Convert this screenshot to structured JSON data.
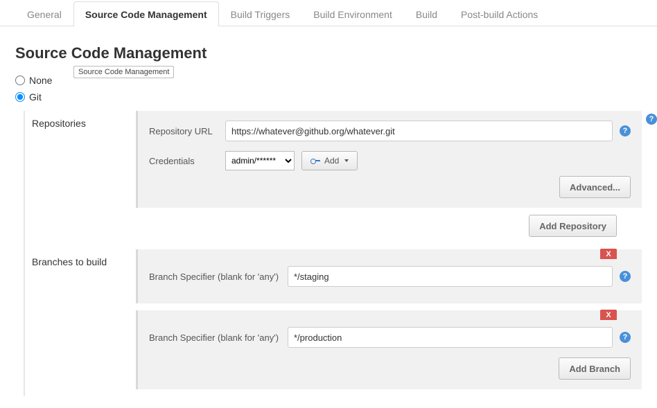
{
  "tabs": [
    {
      "label": "General"
    },
    {
      "label": "Source Code Management"
    },
    {
      "label": "Build Triggers"
    },
    {
      "label": "Build Environment"
    },
    {
      "label": "Build"
    },
    {
      "label": "Post-build Actions"
    }
  ],
  "activeTab": 1,
  "sectionTitle": "Source Code Management",
  "tooltip": "Source Code Management",
  "scmOptions": {
    "none": "None",
    "git": "Git"
  },
  "selectedScm": "git",
  "git": {
    "repositoriesLabel": "Repositories",
    "repoUrlLabel": "Repository URL",
    "repoUrlValue": "https://whatever@github.org/whatever.git",
    "credentialsLabel": "Credentials",
    "credentialsValue": "admin/******",
    "addCredLabel": "Add",
    "advancedLabel": "Advanced...",
    "addRepoLabel": "Add Repository",
    "branchesLabel": "Branches to build",
    "branchSpecifierLabel": "Branch Specifier (blank for 'any')",
    "branches": [
      {
        "value": "*/staging"
      },
      {
        "value": "*/production"
      }
    ],
    "addBranchLabel": "Add Branch",
    "deleteLabel": "X"
  },
  "helpGlyph": "?"
}
